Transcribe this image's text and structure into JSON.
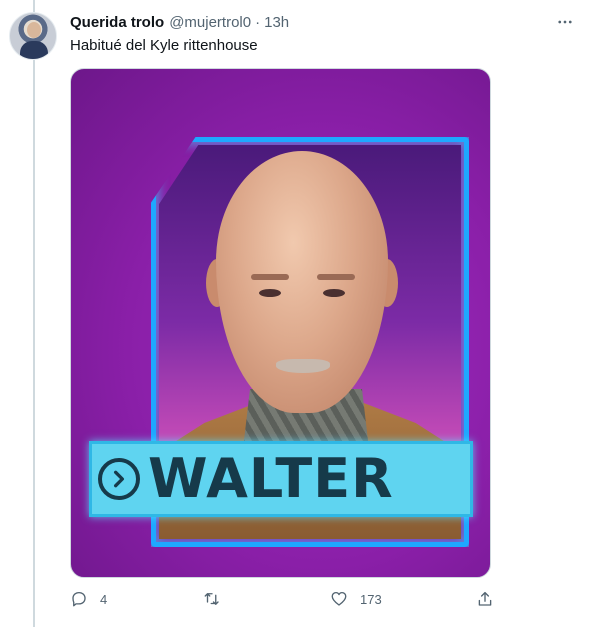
{
  "tweet": {
    "author_name": "Querida trolo",
    "author_handle": "@mujertrol0",
    "separator": "·",
    "time": "13h",
    "text": "Habitué del Kyle rittenhouse",
    "media_card_name": "WALTER"
  },
  "actions": {
    "reply": {
      "icon": "reply-icon",
      "count": "4"
    },
    "retweet": {
      "icon": "retweet-icon",
      "count": ""
    },
    "like": {
      "icon": "heart-icon",
      "count": "173"
    },
    "share": {
      "icon": "share-icon",
      "count": ""
    }
  },
  "colors": {
    "thread_line": "#cfd9de",
    "secondary_text": "#536471",
    "media_background": "#8a1fa8",
    "nameplate": "#5fd4f0",
    "frame_glow": "#1ea8ff"
  }
}
